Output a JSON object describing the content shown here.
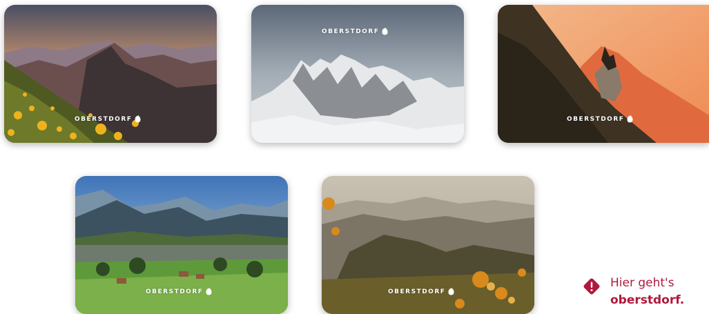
{
  "cards": [
    {
      "brand": "OBERSTDORF",
      "scene": "sunset mountains with yellow flower meadow"
    },
    {
      "brand": "OBERSTDORF",
      "scene": "snowy mountain peaks"
    },
    {
      "brand": "OBERSTDORF",
      "scene": "ibex on ridge at sunset"
    },
    {
      "brand": "OBERSTDORF",
      "scene": "valley with town and green meadows"
    },
    {
      "brand": "OBERSTDORF",
      "scene": "autumn hazy valley view"
    }
  ],
  "notice": {
    "icon": "warning-diamond-icon",
    "line1": "Hier geht's",
    "link": "oberstdorf."
  },
  "colors": {
    "accent": "#b0183d"
  }
}
